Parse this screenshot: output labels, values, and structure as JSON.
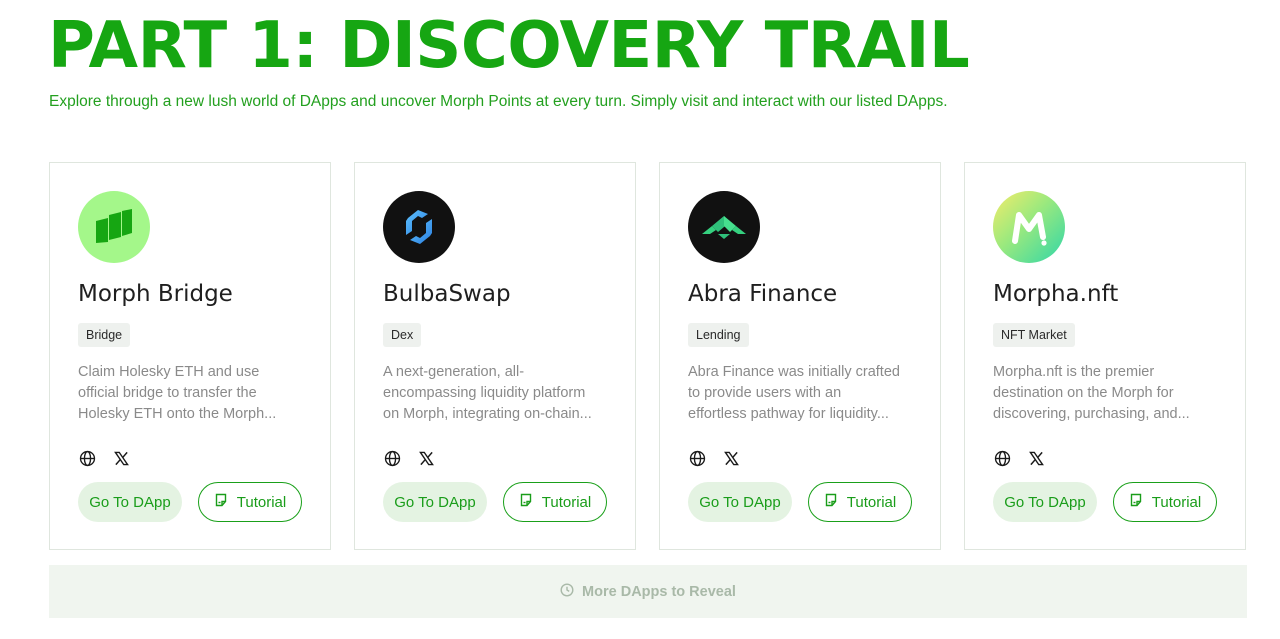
{
  "header": {
    "title": "PART 1: DISCOVERY TRAIL",
    "subtitle": "Explore through a new lush world of DApps and uncover Morph Points at every turn. Simply visit and interact with our listed DApps."
  },
  "colors": {
    "brand_green": "#16a612",
    "button_fill": "#e4f3e2",
    "tag_fill": "#eef1ee",
    "more_bar_fill": "#f0f5ef"
  },
  "cards": [
    {
      "name": "Morph Bridge",
      "tag": "Bridge",
      "description": [
        "Claim Holesky ETH and use",
        "official bridge to transfer the",
        "Holesky ETH onto the Morph..."
      ],
      "logo_icon": "morph-bridge-logo-icon",
      "go_label": "Go To DApp",
      "tutorial_label": "Tutorial"
    },
    {
      "name": "BulbaSwap",
      "tag": "Dex",
      "description": [
        "A next-generation, all-",
        "encompassing liquidity platform",
        "on Morph, integrating on-chain..."
      ],
      "logo_icon": "bulbaswap-logo-icon",
      "go_label": "Go To DApp",
      "tutorial_label": "Tutorial"
    },
    {
      "name": "Abra Finance",
      "tag": "Lending",
      "description": [
        "Abra Finance was initially crafted",
        "to provide users with an",
        "effortless pathway for liquidity..."
      ],
      "logo_icon": "abra-finance-logo-icon",
      "go_label": "Go To DApp",
      "tutorial_label": "Tutorial"
    },
    {
      "name": "Morpha.nft",
      "tag": "NFT Market",
      "description": [
        "Morpha.nft is the premier",
        "destination on the Morph for",
        "discovering, purchasing, and..."
      ],
      "logo_icon": "morpha-nft-logo-icon",
      "go_label": "Go To DApp",
      "tutorial_label": "Tutorial"
    }
  ],
  "icons": {
    "website": "globe-icon",
    "social": "x-icon",
    "tutorial": "document-icon",
    "more": "clock-icon"
  },
  "more_bar": {
    "label": "More DApps to Reveal"
  }
}
